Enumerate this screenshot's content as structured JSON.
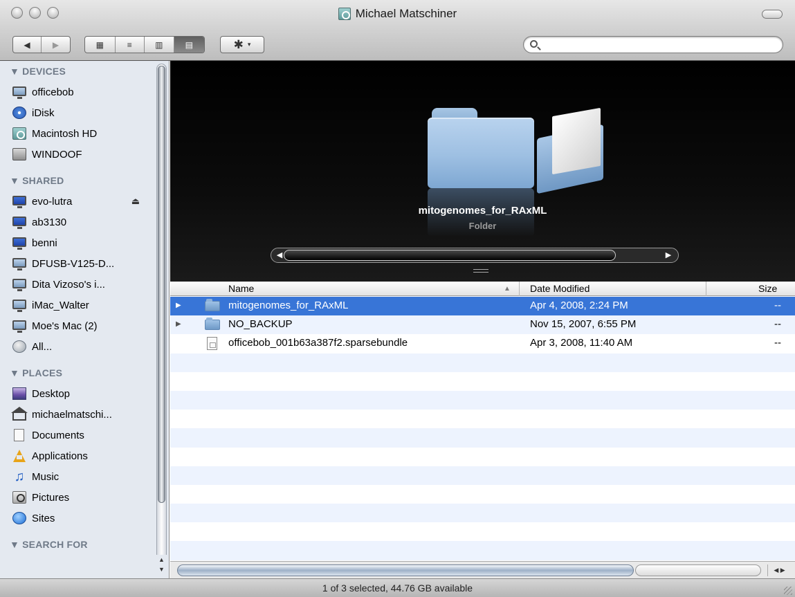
{
  "window": {
    "title": "Michael Matschiner"
  },
  "toolbar": {
    "back_label": "◀",
    "forward_label": "▶",
    "view_icon_label": "▦",
    "view_list_label": "≡",
    "view_column_label": "▥",
    "view_coverflow_label": "▤",
    "action_label": "✱",
    "action_arrow": "▾",
    "search_placeholder": ""
  },
  "sidebar": {
    "sections": {
      "devices": "▼ DEVICES",
      "shared": "▼ SHARED",
      "places": "▼ PLACES",
      "search_for": "▼ SEARCH FOR"
    },
    "devices": [
      {
        "label": "officebob",
        "icon": "monitor-icon"
      },
      {
        "label": "iDisk",
        "icon": "idisk-icon"
      },
      {
        "label": "Macintosh HD",
        "icon": "hard-disk-icon"
      },
      {
        "label": "WINDOOF",
        "icon": "drive-icon"
      }
    ],
    "shared": [
      {
        "label": "evo-lutra",
        "icon": "monitor-icon"
      },
      {
        "label": "ab3130",
        "icon": "monitor-icon"
      },
      {
        "label": "benni",
        "icon": "monitor-icon"
      },
      {
        "label": "DFUSB-V125-D...",
        "icon": "monitor-icon"
      },
      {
        "label": "Dita Vizoso's i...",
        "icon": "monitor-icon"
      },
      {
        "label": "iMac_Walter",
        "icon": "monitor-icon"
      },
      {
        "label": "Moe's Mac (2)",
        "icon": "monitor-icon"
      },
      {
        "label": "All...",
        "icon": "globe-icon"
      }
    ],
    "eject_label": "⏏",
    "places": [
      {
        "label": "Desktop",
        "icon": "desktop-icon"
      },
      {
        "label": "michaelmatschi...",
        "icon": "home-icon"
      },
      {
        "label": "Documents",
        "icon": "documents-icon"
      },
      {
        "label": "Applications",
        "icon": "applications-icon"
      },
      {
        "label": "Music",
        "icon": "music-icon"
      },
      {
        "label": "Pictures",
        "icon": "pictures-icon"
      },
      {
        "label": "Sites",
        "icon": "sites-icon"
      }
    ]
  },
  "coverflow": {
    "selected_name": "mitogenomes_for_RAxML",
    "selected_kind": "Folder"
  },
  "list": {
    "columns": {
      "name": "Name",
      "date": "Date Modified",
      "size": "Size"
    },
    "rows": [
      {
        "name": "mitogenomes_for_RAxML",
        "date": "Apr 4, 2008, 2:24 PM",
        "size": "--",
        "kind": "folder",
        "selected": true
      },
      {
        "name": "NO_BACKUP",
        "date": "Nov 15, 2007, 6:55 PM",
        "size": "--",
        "kind": "folder",
        "selected": false
      },
      {
        "name": "officebob_001b63a387f2.sparsebundle",
        "date": "Apr 3, 2008, 11:40 AM",
        "size": "--",
        "kind": "document",
        "selected": false
      }
    ],
    "disclosure": "▶"
  },
  "status": {
    "text": "1 of 3 selected, 44.76 GB available"
  }
}
